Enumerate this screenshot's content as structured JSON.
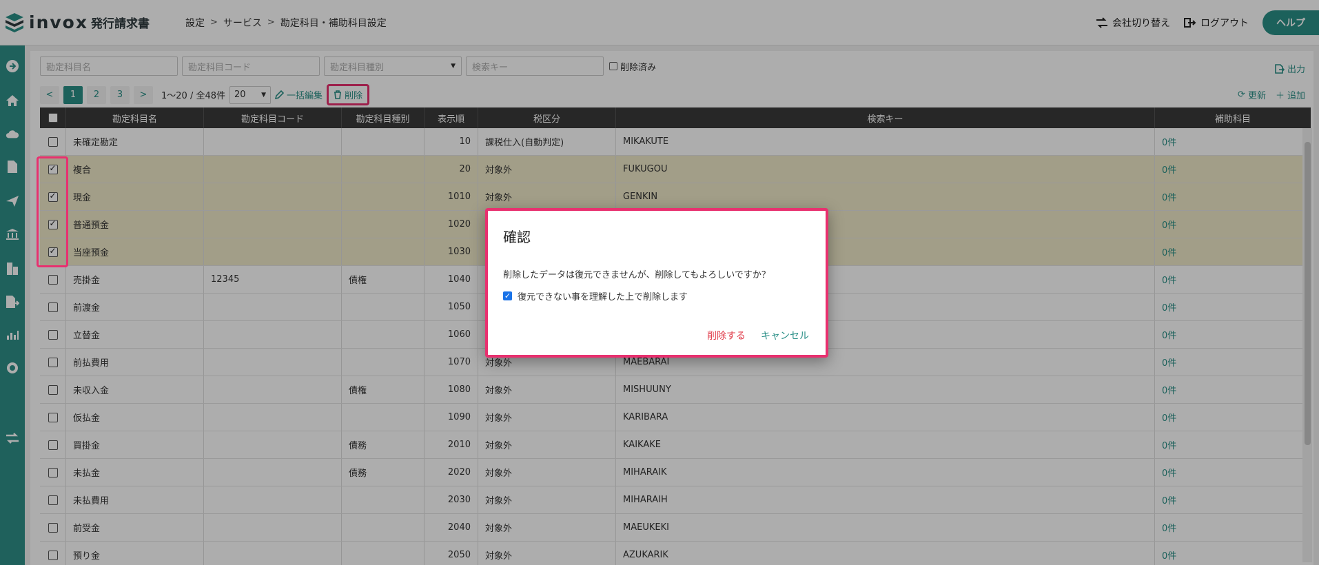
{
  "header": {
    "logo_text": "invox",
    "logo_sub": "発行請求書",
    "breadcrumb": [
      "設定",
      "サービス",
      "勘定科目・補助科目設定"
    ],
    "switch_company": "会社切り替え",
    "logout": "ログアウト",
    "help": "ヘルプ"
  },
  "filters": {
    "name_ph": "勘定科目名",
    "code_ph": "勘定科目コード",
    "type_ph": "勘定科目種別",
    "key_ph": "検索キー",
    "deleted": "削除済み",
    "export": "出力"
  },
  "toolbar": {
    "pages": [
      "1",
      "2",
      "3"
    ],
    "count": "1〜20 / 全48件",
    "page_size": "20",
    "bulk_edit": "一括編集",
    "delete": "削除",
    "refresh": "更新",
    "add": "追加"
  },
  "table": {
    "headers": [
      "勘定科目名",
      "勘定科目コード",
      "勘定科目種別",
      "表示順",
      "税区分",
      "検索キー",
      "補助科目"
    ],
    "rows": [
      {
        "name": "未確定勘定",
        "code": "",
        "type": "",
        "order": "10",
        "tax": "課税仕入(自動判定)",
        "key": "MIKAKUTE",
        "sub": "0件",
        "checked": false
      },
      {
        "name": "複合",
        "code": "",
        "type": "",
        "order": "20",
        "tax": "対象外",
        "key": "FUKUGOU",
        "sub": "0件",
        "checked": true
      },
      {
        "name": "現金",
        "code": "",
        "type": "",
        "order": "1010",
        "tax": "対象外",
        "key": "GENKIN",
        "sub": "0件",
        "checked": true
      },
      {
        "name": "普通預金",
        "code": "",
        "type": "",
        "order": "1020",
        "tax": "",
        "key": "",
        "sub": "0件",
        "checked": true
      },
      {
        "name": "当座預金",
        "code": "",
        "type": "",
        "order": "1030",
        "tax": "",
        "key": "",
        "sub": "0件",
        "checked": true
      },
      {
        "name": "売掛金",
        "code": "12345",
        "type": "債権",
        "order": "1040",
        "tax": "",
        "key": "",
        "sub": "0件",
        "checked": false
      },
      {
        "name": "前渡金",
        "code": "",
        "type": "",
        "order": "1050",
        "tax": "",
        "key": "",
        "sub": "0件",
        "checked": false
      },
      {
        "name": "立替金",
        "code": "",
        "type": "",
        "order": "1060",
        "tax": "",
        "key": "",
        "sub": "0件",
        "checked": false
      },
      {
        "name": "前払費用",
        "code": "",
        "type": "",
        "order": "1070",
        "tax": "対象外",
        "key": "MAEBARAI",
        "sub": "0件",
        "checked": false
      },
      {
        "name": "未収入金",
        "code": "",
        "type": "債権",
        "order": "1080",
        "tax": "対象外",
        "key": "MISHUUNY",
        "sub": "0件",
        "checked": false
      },
      {
        "name": "仮払金",
        "code": "",
        "type": "",
        "order": "1090",
        "tax": "対象外",
        "key": "KARIBARA",
        "sub": "0件",
        "checked": false
      },
      {
        "name": "買掛金",
        "code": "",
        "type": "債務",
        "order": "2010",
        "tax": "対象外",
        "key": "KAIKAKE",
        "sub": "0件",
        "checked": false
      },
      {
        "name": "未払金",
        "code": "",
        "type": "債務",
        "order": "2020",
        "tax": "対象外",
        "key": "MIHARAIK",
        "sub": "0件",
        "checked": false
      },
      {
        "name": "未払費用",
        "code": "",
        "type": "",
        "order": "2030",
        "tax": "対象外",
        "key": "MIHARAIH",
        "sub": "0件",
        "checked": false
      },
      {
        "name": "前受金",
        "code": "",
        "type": "",
        "order": "2040",
        "tax": "対象外",
        "key": "MAEUKEKI",
        "sub": "0件",
        "checked": false
      },
      {
        "name": "預り金",
        "code": "",
        "type": "",
        "order": "2050",
        "tax": "対象外",
        "key": "AZUKARIK",
        "sub": "0件",
        "checked": false
      }
    ]
  },
  "dialog": {
    "title": "確認",
    "message": "削除したデータは復元できませんが、削除してもよろしいですか？",
    "confirm_check": "復元できない事を理解した上で削除します",
    "delete_btn": "削除する",
    "cancel_btn": "キャンセル"
  },
  "colors": {
    "accent": "#2a8f87",
    "highlight": "#e8306f",
    "danger": "#e03c4a"
  }
}
